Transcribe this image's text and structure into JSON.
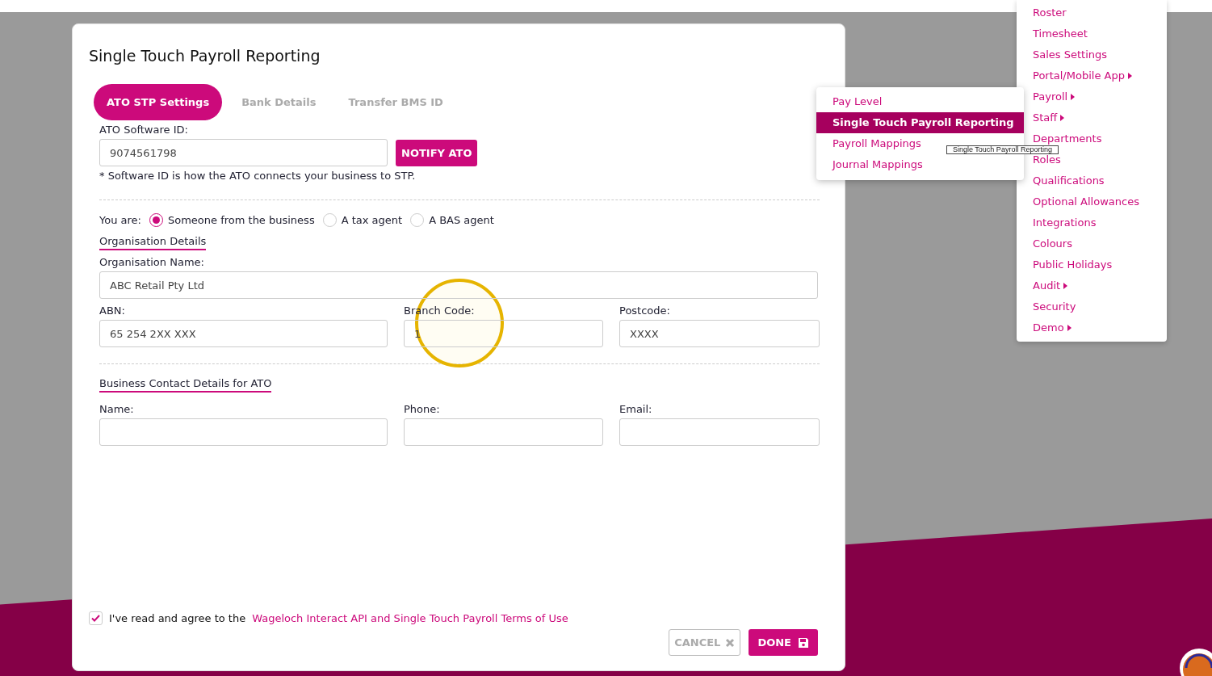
{
  "modal": {
    "title": "Single Touch Payroll Reporting",
    "tabs": [
      {
        "label": "ATO STP Settings",
        "selected": true
      },
      {
        "label": "Bank Details",
        "selected": false
      },
      {
        "label": "Transfer BMS ID",
        "selected": false
      }
    ],
    "software_id": {
      "label": "ATO Software ID:",
      "value": "9074561798",
      "button": "NOTIFY ATO",
      "note": "* Software ID is how the ATO connects your business to STP."
    },
    "you_are": {
      "label": "You are:",
      "options": [
        {
          "label": "Someone from the business",
          "selected": true
        },
        {
          "label": "A tax agent",
          "selected": false
        },
        {
          "label": "A BAS agent",
          "selected": false
        }
      ]
    },
    "organisation": {
      "heading": "Organisation Details",
      "fields": [
        {
          "label": "Organisation Name:",
          "value": "ABC Retail Pty Ltd"
        },
        {
          "label": "ABN:",
          "value": "65 254 2XX XXX"
        },
        {
          "label": "Branch Code:",
          "value": "1"
        },
        {
          "label": "Postcode:",
          "value": "XXXX"
        }
      ]
    },
    "contact": {
      "heading": "Business Contact Details for ATO",
      "fields": [
        {
          "label": "Name:"
        },
        {
          "label": "Phone:"
        },
        {
          "label": "Email:"
        }
      ]
    },
    "agreement": {
      "checked": true,
      "text": "I've read and agree to the",
      "link": "Wageloch Interact API and Single Touch Payroll Terms of Use"
    },
    "buttons": {
      "cancel": "CANCEL",
      "done": "DONE"
    }
  },
  "menu": {
    "items": [
      {
        "label": "Roster",
        "has_submenu": false
      },
      {
        "label": "Timesheet",
        "has_submenu": false
      },
      {
        "label": "Sales Settings",
        "has_submenu": false
      },
      {
        "label": "Portal/Mobile App",
        "has_submenu": true
      },
      {
        "label": "Payroll",
        "has_submenu": true
      },
      {
        "label": "Staff",
        "has_submenu": true
      },
      {
        "label": "Departments",
        "has_submenu": false
      },
      {
        "label": "Roles",
        "has_submenu": false
      },
      {
        "label": "Qualifications",
        "has_submenu": false
      },
      {
        "label": "Optional Allowances",
        "has_submenu": false
      },
      {
        "label": "Integrations",
        "has_submenu": false
      },
      {
        "label": "Colours",
        "has_submenu": false
      },
      {
        "label": "Public Holidays",
        "has_submenu": false
      },
      {
        "label": "Audit",
        "has_submenu": true
      },
      {
        "label": "Security",
        "has_submenu": false
      },
      {
        "label": "Demo",
        "has_submenu": true
      }
    ]
  },
  "submenu": {
    "items": [
      {
        "label": "Pay Level",
        "selected": false
      },
      {
        "label": "Single Touch Payroll Reporting",
        "selected": true
      },
      {
        "label": "Payroll Mappings",
        "selected": false
      },
      {
        "label": "Journal Mappings",
        "selected": false
      }
    ]
  },
  "tooltip": "Single Touch Payroll Reporting"
}
